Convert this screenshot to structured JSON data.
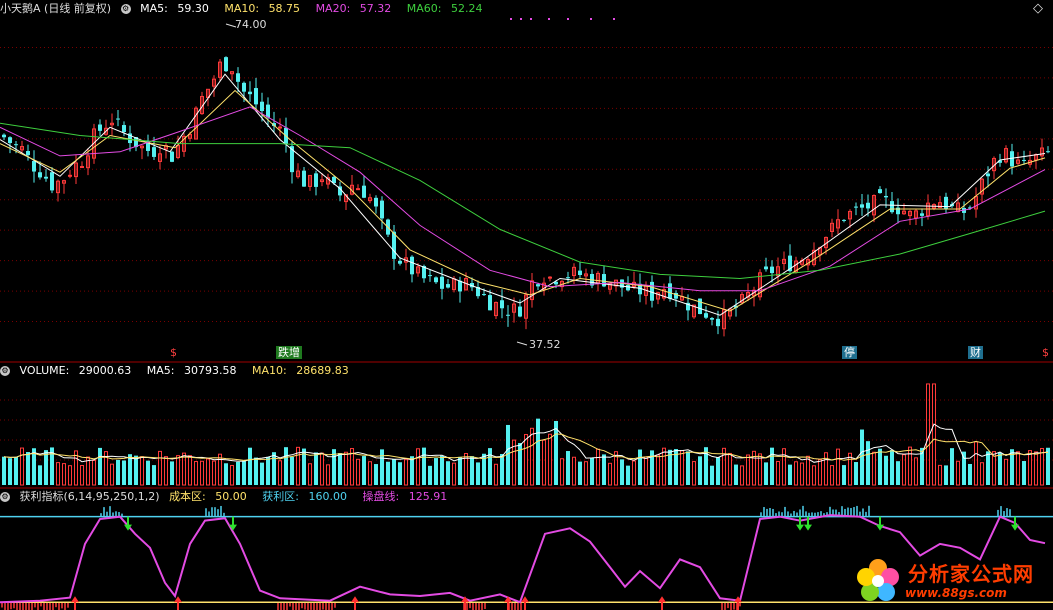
{
  "title": "小天鹅A (日线 前复权)",
  "price_panel": {
    "ma5": {
      "label": "MA5:",
      "value": "59.30",
      "color": "#ffffff"
    },
    "ma10": {
      "label": "MA10:",
      "value": "58.75",
      "color": "#ffe26b"
    },
    "ma20": {
      "label": "MA20:",
      "value": "57.32",
      "color": "#e34be3"
    },
    "ma60": {
      "label": "MA60:",
      "value": "52.24",
      "color": "#3ecf3e"
    },
    "high_label": "74.00",
    "low_label": "37.52",
    "tags": [
      {
        "text": "$",
        "color": "#ff4040"
      },
      {
        "text": "跌增",
        "color": "#ffffff",
        "bg": "#1f7a1f"
      },
      {
        "text": "停",
        "color": "#ffffff",
        "bg": "#1f6f8f"
      },
      {
        "text": "财",
        "color": "#ffffff",
        "bg": "#1f6f8f"
      },
      {
        "text": "$",
        "color": "#ff4040"
      }
    ]
  },
  "volume_panel": {
    "volume": {
      "label": "VOLUME:",
      "value": "29000.63",
      "color": "#ffffff"
    },
    "ma5": {
      "label": "MA5:",
      "value": "30793.58",
      "color": "#ffffff"
    },
    "ma10": {
      "label": "MA10:",
      "value": "28689.83",
      "color": "#ffe26b"
    }
  },
  "indicator_panel": {
    "name": "获利指标(6,14,95,250,1,2)",
    "cost": {
      "label": "成本区:",
      "value": "50.00",
      "color": "#ffe26b"
    },
    "profit": {
      "label": "获利区:",
      "value": "160.00",
      "color": "#4fd2f0"
    },
    "line": {
      "label": "操盘线:",
      "value": "125.91",
      "color": "#e34be3"
    }
  },
  "watermark": {
    "text": "分析家公式网",
    "url": "www.88gs.com"
  },
  "colors": {
    "up": "#ff3a3a",
    "down": "#54f0f0",
    "grid": "#7a0000",
    "ma60": "#3ecf3e",
    "ma20": "#e34be3",
    "ma10": "#ffe26b",
    "ma5": "#ffffff",
    "profit_line": "#4fd2f0",
    "cost_line": "#ffe26b"
  },
  "chart_data": [
    {
      "type": "candlestick",
      "title": "小天鹅A (日线 前复权)",
      "ylim": [
        35,
        76
      ],
      "annotations": [
        {
          "text": "74.00",
          "kind": "high"
        },
        {
          "text": "37.52",
          "kind": "low"
        }
      ],
      "close_points": [
        [
          0,
          61.5
        ],
        [
          10,
          60.5
        ],
        [
          20,
          59.8
        ],
        [
          30,
          58.0
        ],
        [
          40,
          57.0
        ],
        [
          50,
          55.5
        ],
        [
          60,
          56.0
        ],
        [
          70,
          57.5
        ],
        [
          80,
          58.5
        ],
        [
          90,
          61.0
        ],
        [
          100,
          62.5
        ],
        [
          110,
          63.5
        ],
        [
          120,
          62.0
        ],
        [
          130,
          61.0
        ],
        [
          140,
          60.0
        ],
        [
          150,
          59.5
        ],
        [
          160,
          60.5
        ],
        [
          170,
          59.0
        ],
        [
          180,
          61.0
        ],
        [
          190,
          63.0
        ],
        [
          200,
          66.0
        ],
        [
          210,
          68.0
        ],
        [
          220,
          70.5
        ],
        [
          230,
          70.0
        ],
        [
          240,
          67.0
        ],
        [
          250,
          66.0
        ],
        [
          260,
          64.5
        ],
        [
          270,
          63.0
        ],
        [
          280,
          62.0
        ],
        [
          290,
          58.0
        ],
        [
          300,
          56.0
        ],
        [
          310,
          55.5
        ],
        [
          320,
          56.5
        ],
        [
          330,
          55.0
        ],
        [
          340,
          54.0
        ],
        [
          350,
          55.5
        ],
        [
          360,
          55.0
        ],
        [
          370,
          53.5
        ],
        [
          380,
          50.5
        ],
        [
          390,
          47.5
        ],
        [
          400,
          46.0
        ],
        [
          410,
          45.0
        ],
        [
          420,
          44.0
        ],
        [
          430,
          43.5
        ],
        [
          440,
          43.0
        ],
        [
          450,
          43.0
        ],
        [
          460,
          43.5
        ],
        [
          470,
          43.0
        ],
        [
          480,
          42.0
        ],
        [
          490,
          41.0
        ],
        [
          500,
          40.5
        ],
        [
          510,
          40.0
        ],
        [
          520,
          40.5
        ],
        [
          530,
          43.5
        ],
        [
          540,
          44.5
        ],
        [
          550,
          44.0
        ],
        [
          560,
          44.5
        ],
        [
          570,
          44.5
        ],
        [
          580,
          44.5
        ],
        [
          590,
          44.0
        ],
        [
          600,
          44.0
        ],
        [
          610,
          43.5
        ],
        [
          620,
          43.0
        ],
        [
          630,
          42.5
        ],
        [
          640,
          42.5
        ],
        [
          650,
          42.0
        ],
        [
          660,
          43.0
        ],
        [
          670,
          42.5
        ],
        [
          680,
          41.5
        ],
        [
          690,
          40.5
        ],
        [
          700,
          40.0
        ],
        [
          710,
          39.5
        ],
        [
          720,
          39.0
        ],
        [
          730,
          40.0
        ],
        [
          740,
          41.0
        ],
        [
          750,
          42.5
        ],
        [
          760,
          44.0
        ],
        [
          770,
          45.0
        ],
        [
          780,
          45.5
        ],
        [
          790,
          46.0
        ],
        [
          800,
          46.5
        ],
        [
          810,
          47.5
        ],
        [
          820,
          49.0
        ],
        [
          830,
          50.0
        ],
        [
          840,
          51.5
        ],
        [
          850,
          52.0
        ],
        [
          860,
          52.5
        ],
        [
          870,
          53.0
        ],
        [
          880,
          53.5
        ],
        [
          890,
          53.0
        ],
        [
          900,
          52.5
        ],
        [
          910,
          51.5
        ],
        [
          920,
          52.5
        ],
        [
          930,
          53.5
        ],
        [
          940,
          53.5
        ],
        [
          950,
          52.5
        ],
        [
          960,
          52.0
        ],
        [
          970,
          53.0
        ],
        [
          980,
          55.5
        ],
        [
          990,
          58.0
        ],
        [
          1000,
          59.5
        ],
        [
          1010,
          58.5
        ],
        [
          1020,
          57.5
        ],
        [
          1030,
          58.5
        ],
        [
          1045,
          59.3
        ]
      ],
      "ma_lines": [
        {
          "name": "MA5",
          "points": [
            [
              0,
              61.0
            ],
            [
              60,
              56.5
            ],
            [
              110,
              62.5
            ],
            [
              170,
              59.5
            ],
            [
              225,
              69.0
            ],
            [
              280,
              61.0
            ],
            [
              340,
              55.0
            ],
            [
              400,
              46.5
            ],
            [
              470,
              43.2
            ],
            [
              520,
              41.0
            ],
            [
              560,
              44.0
            ],
            [
              640,
              42.8
            ],
            [
              720,
              39.5
            ],
            [
              800,
              46.0
            ],
            [
              880,
              53.0
            ],
            [
              950,
              52.8
            ],
            [
              1000,
              58.5
            ],
            [
              1045,
              59.3
            ]
          ]
        },
        {
          "name": "MA10",
          "points": [
            [
              0,
              60.5
            ],
            [
              60,
              57.0
            ],
            [
              110,
              61.5
            ],
            [
              175,
              60.0
            ],
            [
              235,
              67.0
            ],
            [
              290,
              61.0
            ],
            [
              350,
              55.0
            ],
            [
              410,
              47.5
            ],
            [
              480,
              43.5
            ],
            [
              530,
              42.0
            ],
            [
              580,
              44.0
            ],
            [
              650,
              43.0
            ],
            [
              730,
              40.0
            ],
            [
              810,
              46.0
            ],
            [
              890,
              52.5
            ],
            [
              960,
              52.5
            ],
            [
              1010,
              57.5
            ],
            [
              1045,
              58.75
            ]
          ]
        },
        {
          "name": "MA20",
          "points": [
            [
              0,
              62.5
            ],
            [
              60,
              59.0
            ],
            [
              120,
              59.5
            ],
            [
              180,
              62.0
            ],
            [
              250,
              65.0
            ],
            [
              300,
              61.5
            ],
            [
              360,
              57.0
            ],
            [
              420,
              50.5
            ],
            [
              490,
              45.0
            ],
            [
              550,
              43.0
            ],
            [
              620,
              43.5
            ],
            [
              700,
              42.5
            ],
            [
              760,
              42.5
            ],
            [
              830,
              45.5
            ],
            [
              900,
              51.0
            ],
            [
              970,
              52.5
            ],
            [
              1045,
              57.32
            ]
          ]
        },
        {
          "name": "MA60",
          "points": [
            [
              0,
              63.0
            ],
            [
              80,
              61.5
            ],
            [
              180,
              60.5
            ],
            [
              280,
              60.5
            ],
            [
              350,
              60.0
            ],
            [
              420,
              56.0
            ],
            [
              500,
              50.0
            ],
            [
              580,
              46.0
            ],
            [
              660,
              44.5
            ],
            [
              740,
              44.0
            ],
            [
              820,
              45.0
            ],
            [
              900,
              47.0
            ],
            [
              970,
              49.5
            ],
            [
              1045,
              52.24
            ]
          ]
        }
      ]
    },
    {
      "type": "bar",
      "title": "VOLUME",
      "ylim": [
        0,
        90000
      ],
      "series": [
        {
          "name": "VOLUME",
          "latest": 29000.63
        }
      ],
      "ma": {
        "MA5": 30793.58,
        "MA10": 28689.83
      }
    },
    {
      "type": "line",
      "title": "获利指标(6,14,95,250,1,2)",
      "ylim": [
        40,
        175
      ],
      "levels": [
        {
          "name": "成本区",
          "value": 50.0
        },
        {
          "name": "获利区",
          "value": 160.0
        }
      ],
      "series": [
        {
          "name": "操盘线",
          "latest": 125.91,
          "points": [
            [
              0,
              50
            ],
            [
              40,
              52
            ],
            [
              70,
              56
            ],
            [
              85,
              125
            ],
            [
              100,
              157
            ],
            [
              120,
              160
            ],
            [
              135,
              138
            ],
            [
              150,
              120
            ],
            [
              165,
              75
            ],
            [
              175,
              58
            ],
            [
              190,
              125
            ],
            [
              205,
              155
            ],
            [
              225,
              158
            ],
            [
              240,
              125
            ],
            [
              260,
              65
            ],
            [
              280,
              55
            ],
            [
              330,
              52
            ],
            [
              360,
              70
            ],
            [
              390,
              60
            ],
            [
              420,
              58
            ],
            [
              450,
              62
            ],
            [
              470,
              52
            ],
            [
              500,
              60
            ],
            [
              520,
              50
            ],
            [
              545,
              138
            ],
            [
              570,
              145
            ],
            [
              590,
              128
            ],
            [
              610,
              95
            ],
            [
              625,
              70
            ],
            [
              640,
              90
            ],
            [
              660,
              68
            ],
            [
              680,
              105
            ],
            [
              700,
              95
            ],
            [
              720,
              55
            ],
            [
              740,
              52
            ],
            [
              760,
              157
            ],
            [
              780,
              160
            ],
            [
              800,
              155
            ],
            [
              830,
              162
            ],
            [
              860,
              160
            ],
            [
              880,
              148
            ],
            [
              900,
              140
            ],
            [
              920,
              110
            ],
            [
              940,
              125
            ],
            [
              960,
              120
            ],
            [
              980,
              105
            ],
            [
              1000,
              160
            ],
            [
              1015,
              152
            ],
            [
              1030,
              130
            ],
            [
              1045,
              125.91
            ]
          ]
        }
      ]
    }
  ]
}
